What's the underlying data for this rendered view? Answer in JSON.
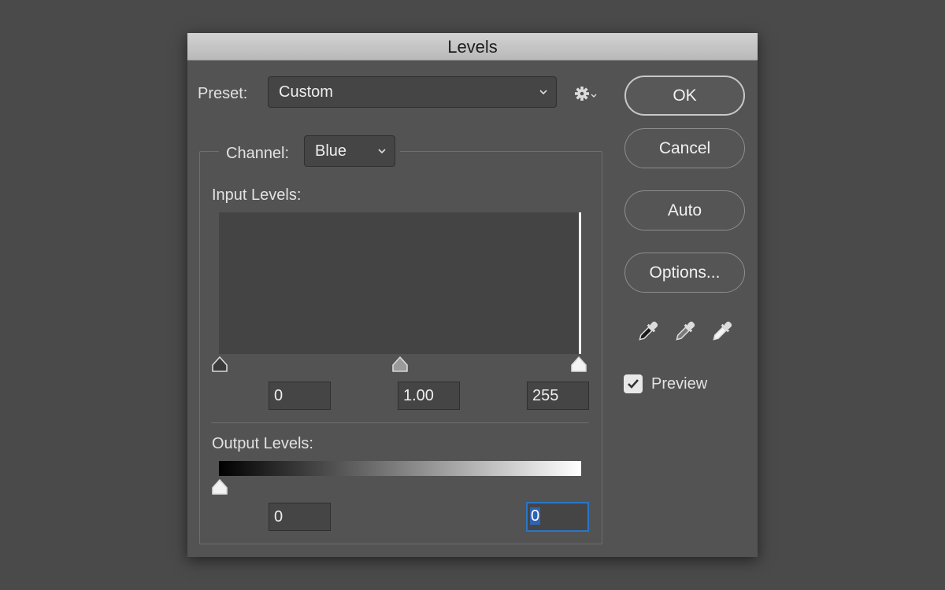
{
  "dialog": {
    "title": "Levels"
  },
  "preset": {
    "label": "Preset:",
    "value": "Custom"
  },
  "channel": {
    "label": "Channel:",
    "value": "Blue"
  },
  "input_levels": {
    "label": "Input Levels:",
    "black": "0",
    "mid": "1.00",
    "white": "255"
  },
  "output_levels": {
    "label": "Output Levels:",
    "black": "0",
    "white": "0"
  },
  "buttons": {
    "ok": "OK",
    "cancel": "Cancel",
    "auto": "Auto",
    "options": "Options..."
  },
  "preview": {
    "label": "Preview",
    "checked": true
  },
  "icons": {
    "gear": "gear-icon",
    "black_eyedropper": "black-eyedropper-icon",
    "gray_eyedropper": "gray-eyedropper-icon",
    "white_eyedropper": "white-eyedropper-icon"
  },
  "colors": {
    "dialog_bg": "#535353",
    "field_bg": "#454545",
    "focus": "#2a76c6"
  }
}
